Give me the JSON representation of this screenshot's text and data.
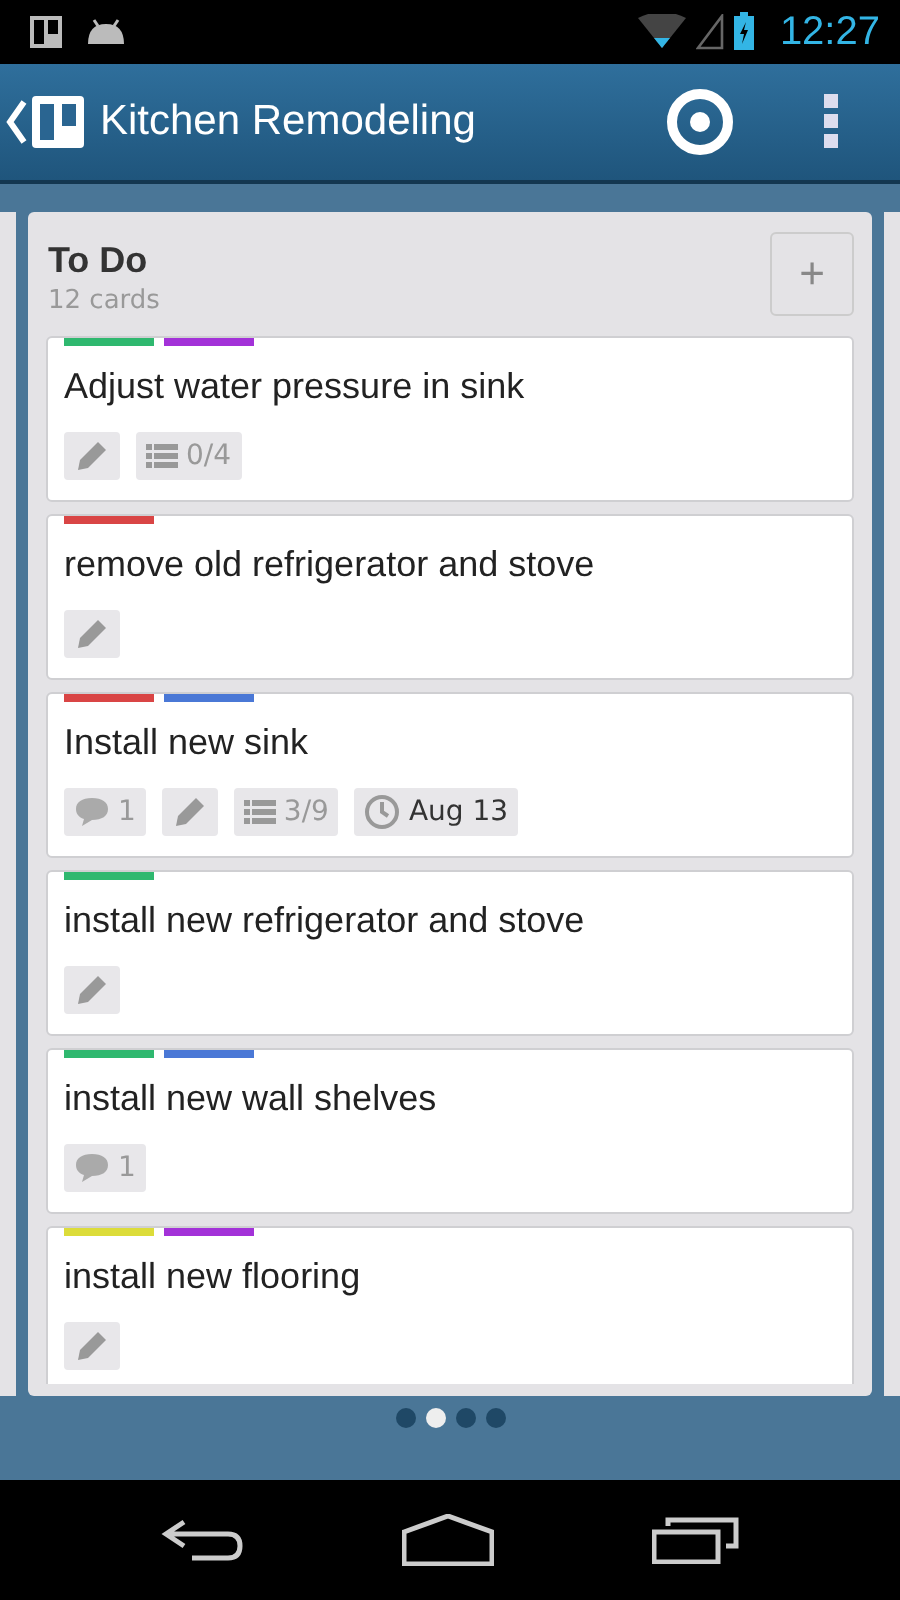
{
  "status_bar": {
    "time": "12:27"
  },
  "app_bar": {
    "title": "Kitchen Remodeling"
  },
  "list": {
    "title": "To Do",
    "count": "12 cards",
    "add_label": "+",
    "cards": [
      {
        "title": "Adjust water pressure in sink",
        "labels": [
          {
            "color": "#2fb86f"
          },
          {
            "color": "#a332d8"
          }
        ],
        "badges": [
          {
            "kind": "description"
          },
          {
            "kind": "checklist",
            "text": "0/4"
          }
        ]
      },
      {
        "title": "remove old refrigerator and stove",
        "labels": [
          {
            "color": "#d94545"
          }
        ],
        "badges": [
          {
            "kind": "description"
          }
        ]
      },
      {
        "title": "Install new sink",
        "labels": [
          {
            "color": "#d94545"
          },
          {
            "color": "#4a78d6"
          }
        ],
        "badges": [
          {
            "kind": "comments",
            "text": "1"
          },
          {
            "kind": "description"
          },
          {
            "kind": "checklist",
            "text": "3/9"
          },
          {
            "kind": "due",
            "text": "Aug 13"
          }
        ]
      },
      {
        "title": "install new refrigerator and stove",
        "labels": [
          {
            "color": "#2fb86f"
          }
        ],
        "badges": [
          {
            "kind": "description"
          }
        ]
      },
      {
        "title": "install new wall shelves",
        "labels": [
          {
            "color": "#2fb86f"
          },
          {
            "color": "#4a78d6"
          }
        ],
        "badges": [
          {
            "kind": "comments",
            "text": "1"
          }
        ]
      },
      {
        "title": "install new flooring",
        "labels": [
          {
            "color": "#dcdc3a"
          },
          {
            "color": "#a332d8"
          }
        ],
        "badges": [
          {
            "kind": "description"
          }
        ]
      }
    ]
  },
  "pager": [
    {
      "selected": false
    },
    {
      "selected": true
    },
    {
      "selected": false
    },
    {
      "selected": false
    }
  ]
}
